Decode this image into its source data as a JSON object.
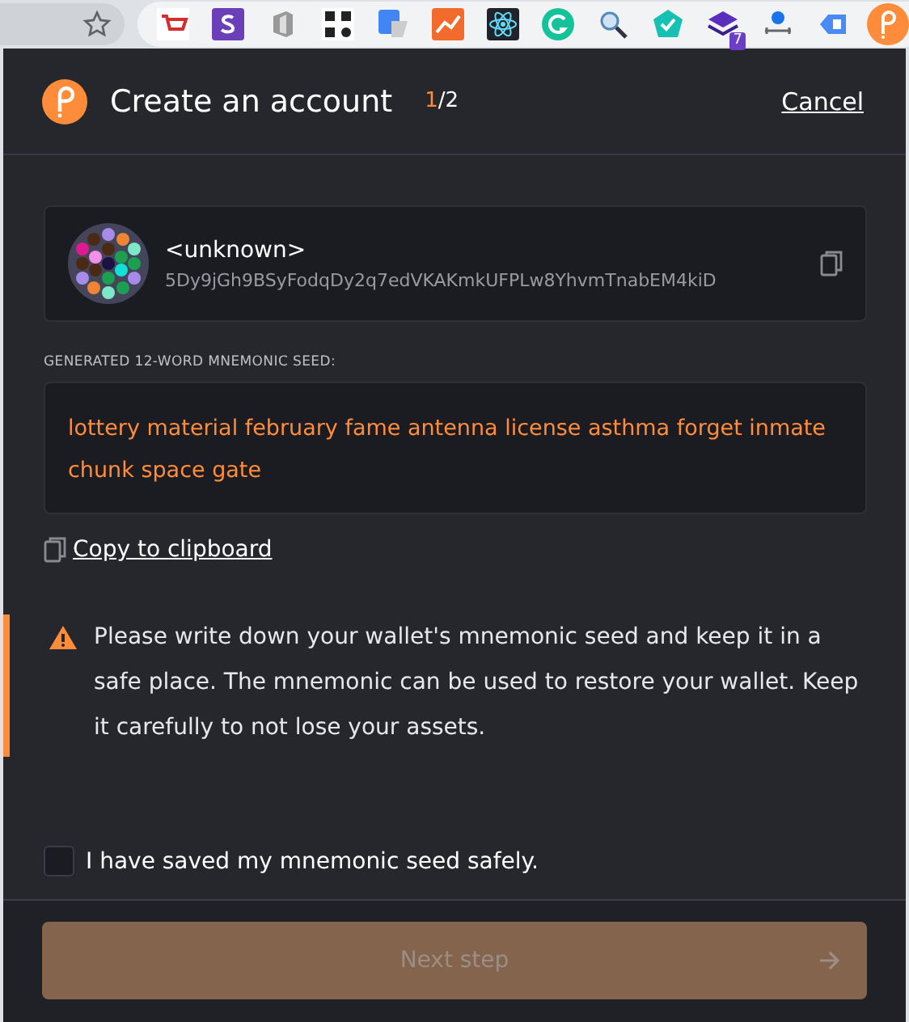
{
  "browser_toolbar": {
    "extension_badge": "7"
  },
  "header": {
    "title": "Create an account",
    "step_current": "1",
    "step_rest": "/2",
    "cancel": "Cancel"
  },
  "account": {
    "name": "<unknown>",
    "address": "5Dy9jGh9BSyFodqDy2q7edVKAKmkUFPLw8YhvmTnabEM4kiD"
  },
  "seed": {
    "label": "GENERATED 12-WORD MNEMONIC SEED:",
    "value": "lottery material february fame antenna license asthma forget inmate chunk space gate"
  },
  "copy_link": "Copy to clipboard",
  "warning": "Please write down your wallet's mnemonic seed and keep it in a safe place. The mnemonic can be used to restore your wallet. Keep it carefully to not lose your assets.",
  "confirm": {
    "label": "I have saved my mnemonic seed safely.",
    "checked": false
  },
  "next_button": {
    "label": "Next step",
    "disabled": true
  }
}
